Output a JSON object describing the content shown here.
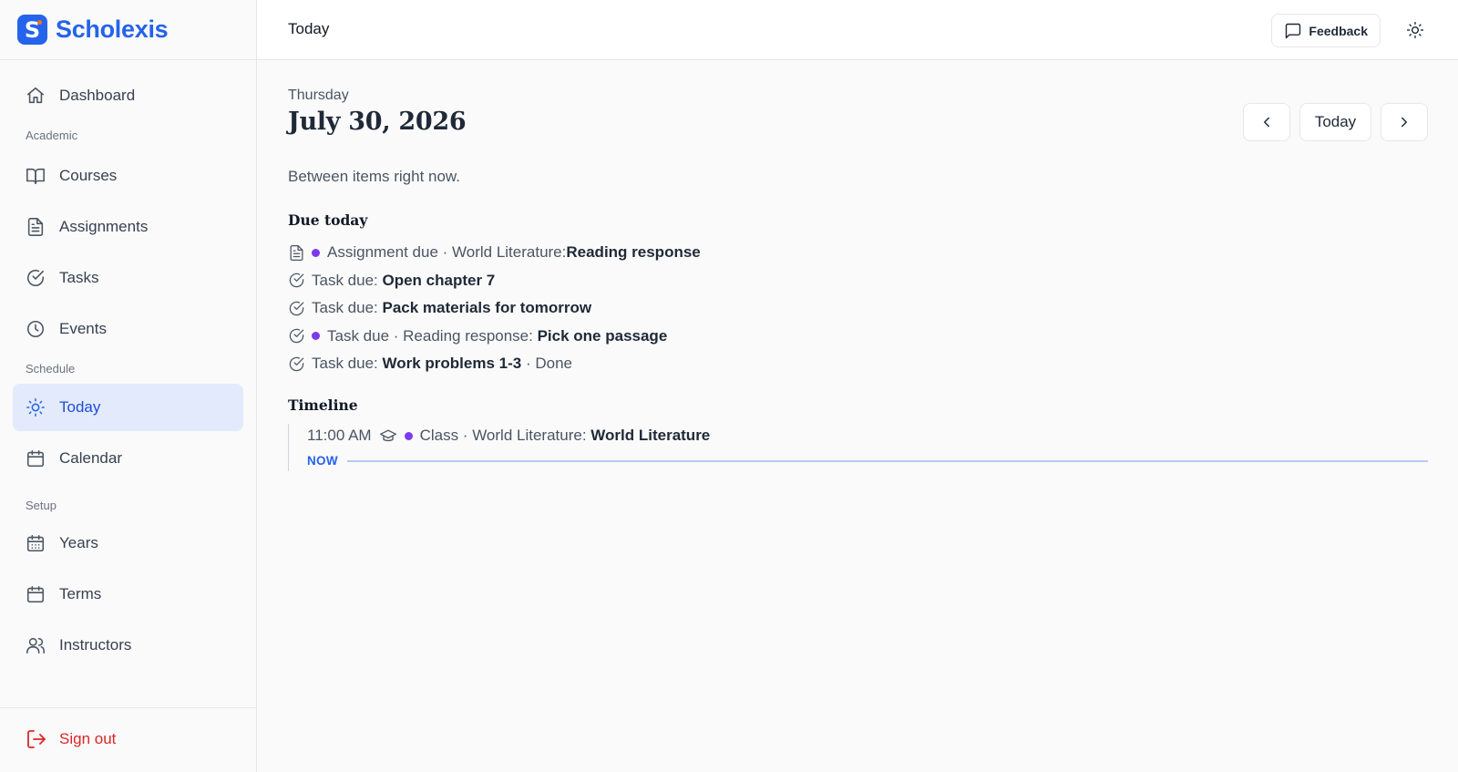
{
  "app": {
    "name": "Scholexis",
    "logo_letter": "S"
  },
  "sidebar": {
    "dashboard": "Dashboard",
    "sections": {
      "academic": "Academic",
      "schedule": "Schedule",
      "setup": "Setup"
    },
    "items": {
      "courses": "Courses",
      "assignments": "Assignments",
      "tasks": "Tasks",
      "events": "Events",
      "today": "Today",
      "calendar": "Calendar",
      "years": "Years",
      "terms": "Terms",
      "instructors": "Instructors"
    },
    "active": "Today",
    "sign_out": "Sign out"
  },
  "header": {
    "title": "Today",
    "feedback_label": "Feedback"
  },
  "day": {
    "weekday": "Thursday",
    "date": "July 30, 2026",
    "status": "Between items right now.",
    "nav_today": "Today"
  },
  "due_today": {
    "title": "Due today",
    "items": [
      {
        "prefix": "Assignment due · World Literature: ",
        "name": "Reading response",
        "suffix": ""
      },
      {
        "prefix": "Task due: ",
        "name": "Open chapter 7",
        "suffix": ""
      },
      {
        "prefix": "Task due: ",
        "name": "Pack materials for tomorrow",
        "suffix": ""
      },
      {
        "prefix": "Task due · Reading response: ",
        "name": "Pick one passage",
        "suffix": ""
      },
      {
        "prefix": "Task due: ",
        "name": "Work problems 1-3",
        "suffix": " · Done"
      }
    ]
  },
  "timeline": {
    "title": "Timeline",
    "items": [
      {
        "time": "11:00 AM",
        "prefix": "Class · World Literature: ",
        "name": "World Literature"
      }
    ],
    "now_label": "NOW"
  },
  "colors": {
    "accent": "#2563eb",
    "course_dot": "#7c3aed",
    "danger": "#dc2626"
  }
}
